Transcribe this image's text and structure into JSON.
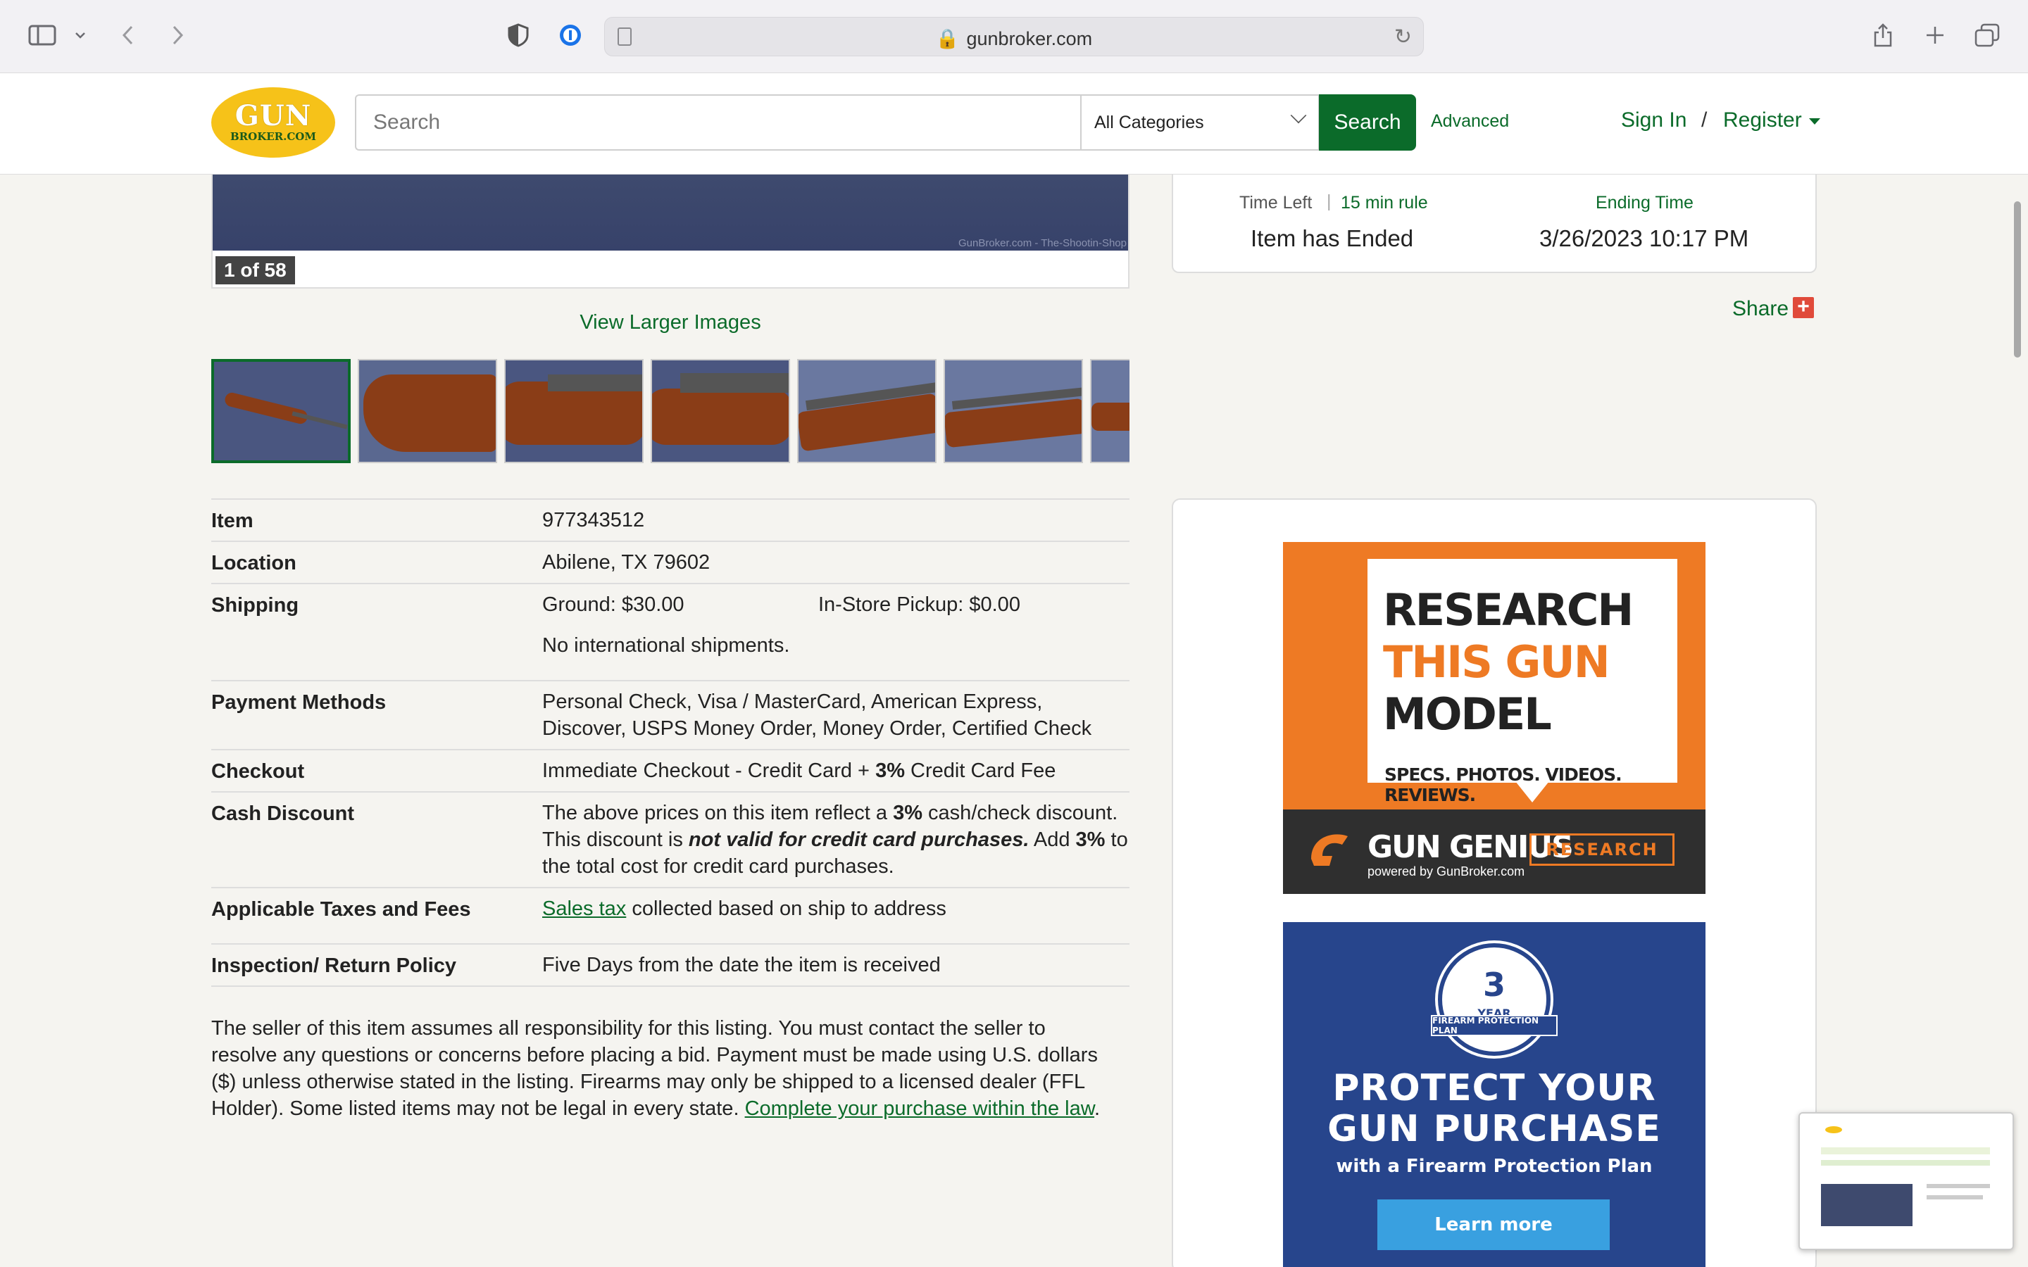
{
  "browser": {
    "url": "gunbroker.com"
  },
  "header": {
    "logo_line1": "GUN",
    "logo_line2": "BROKER.COM",
    "search_placeholder": "Search",
    "category": "All Categories",
    "search_button": "Search",
    "advanced": "Advanced",
    "sign_in": "Sign In",
    "separator": "/",
    "register": "Register"
  },
  "gallery": {
    "watermark": "GunBroker.com - The-Shootin-Shop",
    "counter": "1 of 58",
    "view_larger": "View Larger Images",
    "thumbnail_count": 7
  },
  "auction": {
    "time_left_label": "Time Left",
    "separator": "|",
    "rule_link": "15 min rule",
    "status": "Item has Ended",
    "ending_time_label": "Ending Time",
    "ending_time": "3/26/2023 10:17 PM",
    "share": "Share",
    "share_plus": "+"
  },
  "details": {
    "item_label": "Item",
    "item_value": "977343512",
    "location_label": "Location",
    "location_value": "Abilene, TX 79602",
    "shipping_label": "Shipping",
    "shipping_ground": "Ground:  $30.00",
    "shipping_pickup": "In-Store Pickup:  $0.00",
    "shipping_intl": "No international shipments.",
    "payment_label": "Payment Methods",
    "payment_line1": "Personal Check, Visa / MasterCard, American Express,",
    "payment_line2": "Discover, USPS Money Order, Money Order, Certified Check",
    "checkout_label": "Checkout",
    "checkout_pre": "Immediate Checkout - Credit Card + ",
    "checkout_bold": "3%",
    "checkout_post": " Credit Card Fee",
    "cash_label": "Cash Discount",
    "cash_l1_pre": "The above prices on this item reflect a ",
    "cash_l1_bold": "3%",
    "cash_l1_post": " cash/check discount.",
    "cash_l2_pre": "This discount is ",
    "cash_l2_bold": "not valid for credit card purchases.",
    "cash_l2_mid": " Add ",
    "cash_l2_bold2": "3%",
    "cash_l2_post": " to",
    "cash_l3": "the total cost for credit card purchases.",
    "taxes_label": "Applicable Taxes and Fees",
    "taxes_link": "Sales tax",
    "taxes_post": " collected based on ship to address",
    "return_label": "Inspection/ Return Policy",
    "return_value": "Five Days from the date the item is received"
  },
  "disclaimer": {
    "l1": "The seller of this item assumes all responsibility for this listing. You must contact the seller to",
    "l2": "resolve any questions or concerns before placing a bid. Payment must be made using U.S. dollars",
    "l3": "($) unless otherwise stated in the listing. Firearms may only be shipped to a licensed dealer (FFL",
    "l4_pre": "Holder). Some listed items may not be legal in every state. ",
    "l4_link": "Complete your purchase within the law",
    "l4_post": "."
  },
  "ads": {
    "ad1_line1": "RESEARCH",
    "ad1_line2": "THIS GUN",
    "ad1_line3": "MODEL",
    "ad1_sub": "SPECS. PHOTOS. VIDEOS. REVIEWS.",
    "ad1_brand": "GUN GENIUS",
    "ad1_powered": "powered by GunBroker.com",
    "ad1_button": "RESEARCH",
    "ad1_accent": "#ee7a24",
    "ad2_badge_num": "3",
    "ad2_badge_year": "YEAR",
    "ad2_ribbon": "FIREARM PROTECTION PLAN",
    "ad2_line1": "PROTECT YOUR",
    "ad2_line2": "GUN PURCHASE",
    "ad2_sub": "with a Firearm Protection Plan",
    "ad2_button": "Learn more"
  },
  "colors": {
    "brand_green": "#0b6b2a",
    "brand_yellow": "#f6c219",
    "ad2_blue": "#27458c"
  }
}
